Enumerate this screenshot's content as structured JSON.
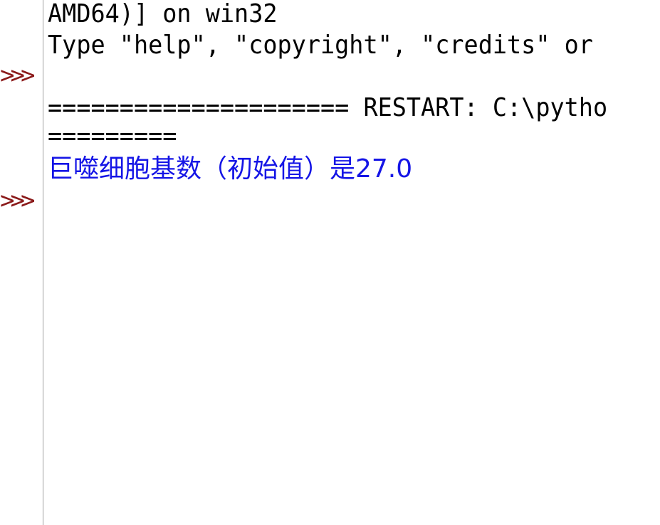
{
  "shell": {
    "prompt": ">>>",
    "lines": [
      {
        "text": "AMD64)] on win32",
        "kind": "banner"
      },
      {
        "text": "Type \"help\", \"copyright\", \"credits\" or",
        "kind": "banner"
      },
      {
        "text": "",
        "kind": "blank"
      },
      {
        "text": "===================== RESTART: C:\\pytho",
        "kind": "restart"
      },
      {
        "text": "=========",
        "kind": "restart"
      },
      {
        "text": "巨噬细胞基数（初始值）是27.0",
        "kind": "output"
      }
    ]
  },
  "colors": {
    "prompt": "#8b1a1a",
    "stdout": "#1515e6",
    "text": "#000000",
    "background": "#ffffff"
  }
}
